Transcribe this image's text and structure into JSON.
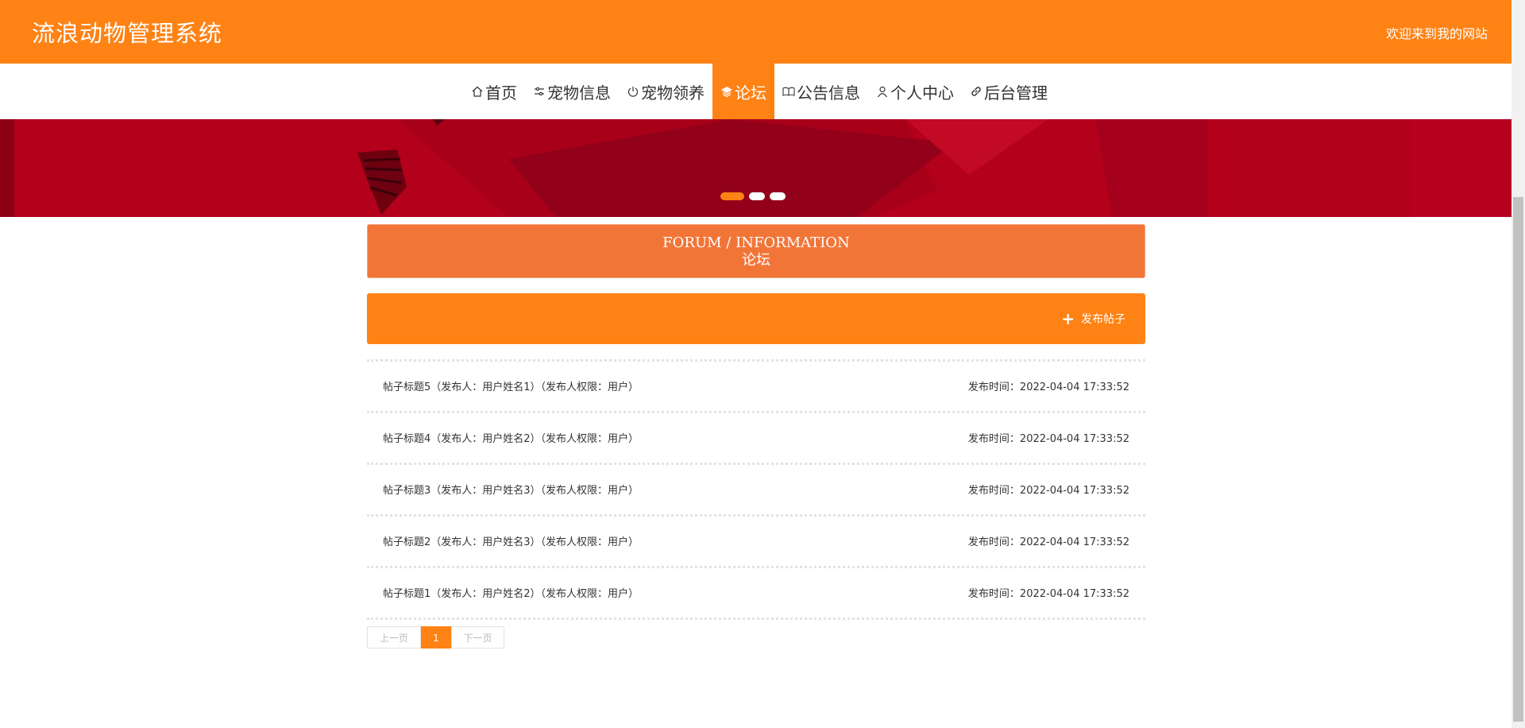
{
  "header": {
    "site_title": "流浪动物管理系统",
    "welcome": "欢迎来到我的网站"
  },
  "nav": {
    "items": [
      {
        "label": "首页",
        "icon": "home-icon"
      },
      {
        "label": "宠物信息",
        "icon": "sliders-icon"
      },
      {
        "label": "宠物领养",
        "icon": "power-icon"
      },
      {
        "label": "论坛",
        "icon": "layers-icon"
      },
      {
        "label": "公告信息",
        "icon": "book-icon"
      },
      {
        "label": "个人中心",
        "icon": "user-icon"
      },
      {
        "label": "后台管理",
        "icon": "link-icon"
      }
    ],
    "active_index": 3
  },
  "banner": {
    "slide_count": 3,
    "active_slide": 1
  },
  "section": {
    "title_en": "FORUM / INFORMATION",
    "title_cn": "论坛"
  },
  "actions": {
    "post_label": "发布帖子"
  },
  "posts": [
    {
      "title": "帖子标题5（发布人：用户姓名1）（发布人权限：用户）",
      "time": "发布时间：2022-04-04 17:33:52"
    },
    {
      "title": "帖子标题4（发布人：用户姓名2）（发布人权限：用户）",
      "time": "发布时间：2022-04-04 17:33:52"
    },
    {
      "title": "帖子标题3（发布人：用户姓名3）（发布人权限：用户）",
      "time": "发布时间：2022-04-04 17:33:52"
    },
    {
      "title": "帖子标题2（发布人：用户姓名3）（发布人权限：用户）",
      "time": "发布时间：2022-04-04 17:33:52"
    },
    {
      "title": "帖子标题1（发布人：用户姓名2）（发布人权限：用户）",
      "time": "发布时间：2022-04-04 17:33:52"
    }
  ],
  "pagination": {
    "prev_label": "上一页",
    "current_page": "1",
    "next_label": "下一页"
  },
  "colors": {
    "brand": "#ff8214",
    "section_title": "#f27538",
    "banner_red": "#b0001c"
  }
}
